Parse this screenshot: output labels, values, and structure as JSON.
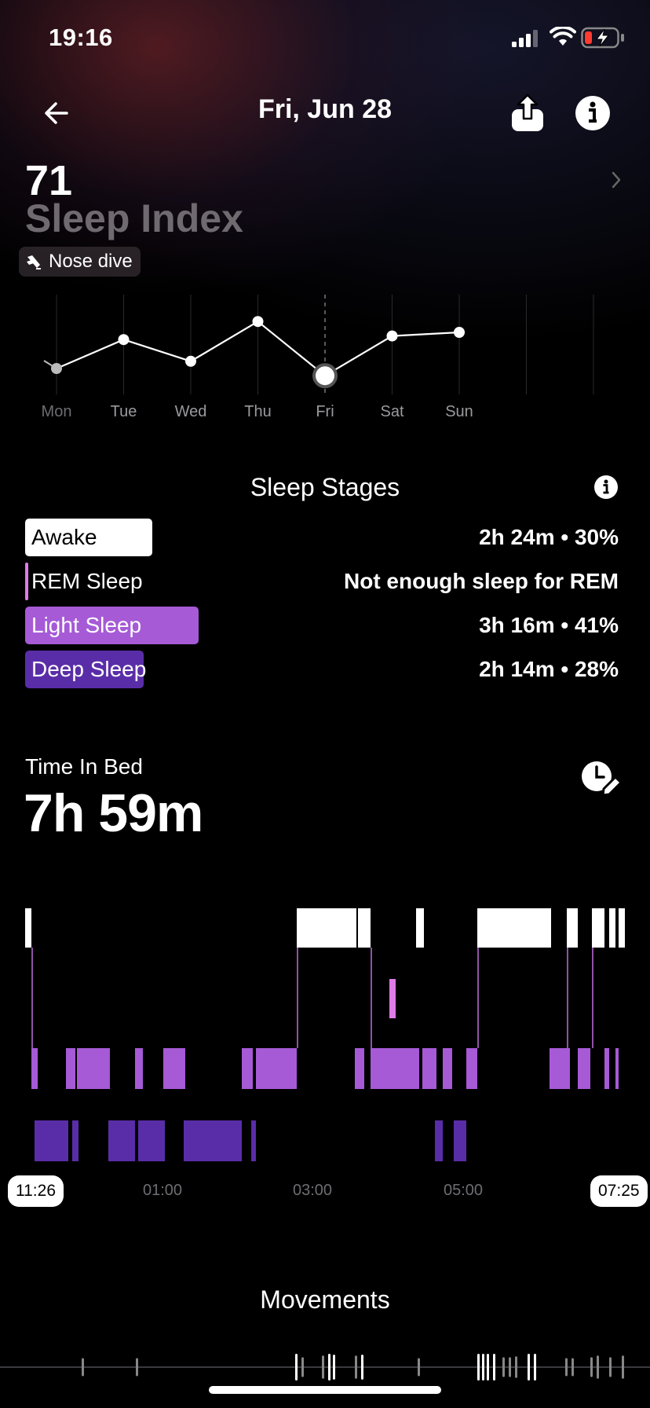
{
  "status_bar": {
    "time": "19:16"
  },
  "header": {
    "date": "Fri, Jun 28"
  },
  "score": {
    "value": "71",
    "label": "Sleep Index",
    "badge": "Nose dive"
  },
  "week_chart": {
    "days": [
      "Mon",
      "Tue",
      "Wed",
      "Thu",
      "Fri",
      "Sat",
      "Sun"
    ],
    "values": [
      73,
      81,
      75,
      86,
      71,
      82,
      83
    ],
    "selected": "Fri"
  },
  "stages": {
    "title": "Sleep Stages",
    "items": [
      {
        "label": "Awake",
        "value": "2h 24m • 30%",
        "percent": 30,
        "color": "#ffffff",
        "text_color": "#000000"
      },
      {
        "label": "REM Sleep",
        "value": "Not enough sleep for REM",
        "percent": 0,
        "color": "#e07ae8",
        "text_color": "#ffffff"
      },
      {
        "label": "Light Sleep",
        "value": "3h 16m • 41%",
        "percent": 41,
        "color": "#a65ad6",
        "text_color": "#ffffff"
      },
      {
        "label": "Deep Sleep",
        "value": "2h 14m • 28%",
        "percent": 28,
        "color": "#5a2da8",
        "text_color": "#ffffff"
      }
    ]
  },
  "time_in_bed": {
    "label": "Time In Bed",
    "value": "7h 59m"
  },
  "hypnogram": {
    "start": "11:26",
    "end": "07:25",
    "ticks": [
      "01:00",
      "03:00",
      "05:00"
    ],
    "colors": {
      "awake": "#ffffff",
      "rem": "#e07ae8",
      "light": "#a65ad6",
      "deep": "#5a2da8"
    }
  },
  "movements": {
    "title": "Movements"
  }
}
